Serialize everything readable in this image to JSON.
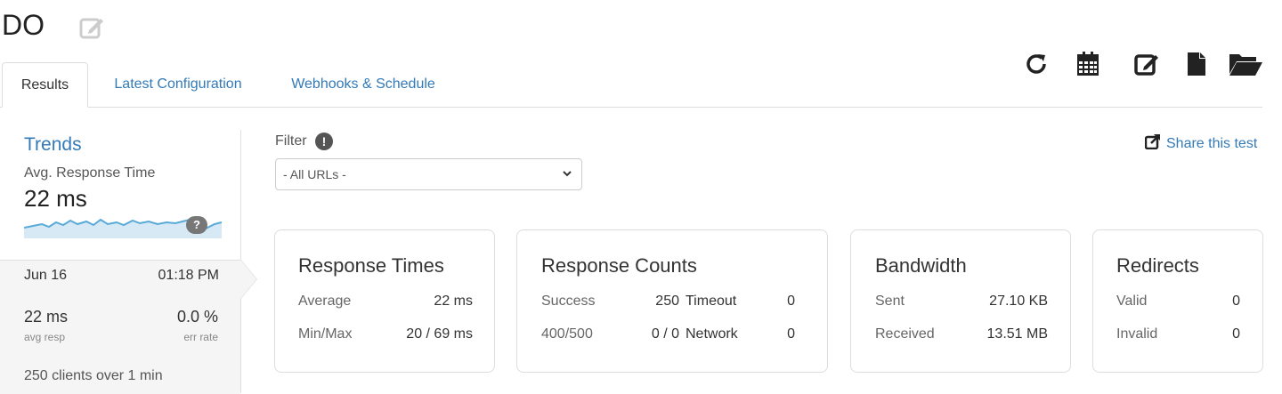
{
  "page": {
    "title": "DO"
  },
  "toolbar": {
    "refresh_icon": "refresh-icon",
    "calendar_icon": "calendar-icon",
    "edit_icon": "edit-icon",
    "document_icon": "document-icon",
    "folder_icon": "folder-open-icon"
  },
  "tabs": [
    {
      "label": "Results",
      "active": true
    },
    {
      "label": "Latest Configuration",
      "active": false
    },
    {
      "label": "Webhooks & Schedule",
      "active": false
    }
  ],
  "sidebar": {
    "trends_label": "Trends",
    "avg_label": "Avg. Response Time",
    "avg_value": "22 ms",
    "help_badge": "?",
    "run": {
      "date": "Jun 16",
      "time": "01:18 PM",
      "avg_resp": "22 ms",
      "avg_resp_label": "avg resp",
      "err_rate": "0.0 %",
      "err_rate_label": "err rate",
      "clients_text": "250 clients over 1 min"
    }
  },
  "filter": {
    "label": "Filter",
    "info_badge": "!",
    "selected": "- All URLs -"
  },
  "share": {
    "label": "Share this test"
  },
  "cards": {
    "response_times": {
      "title": "Response Times",
      "average_label": "Average",
      "average_value": "22 ms",
      "minmax_label": "Min/Max",
      "minmax_value": "20 / 69 ms"
    },
    "response_counts": {
      "title": "Response Counts",
      "success_label": "Success",
      "success_value": "250",
      "timeout_label": "Timeout",
      "timeout_value": "0",
      "err_label": "400/500",
      "err_value": "0 / 0",
      "network_label": "Network",
      "network_value": "0"
    },
    "bandwidth": {
      "title": "Bandwidth",
      "sent_label": "Sent",
      "sent_value": "27.10 KB",
      "received_label": "Received",
      "received_value": "13.51 MB"
    },
    "redirects": {
      "title": "Redirects",
      "valid_label": "Valid",
      "valid_value": "0",
      "invalid_label": "Invalid",
      "invalid_value": "0"
    }
  },
  "colors": {
    "link": "#337ab7",
    "sparkline": "#5aaad8",
    "sparkfill": "#d6e9f5"
  }
}
